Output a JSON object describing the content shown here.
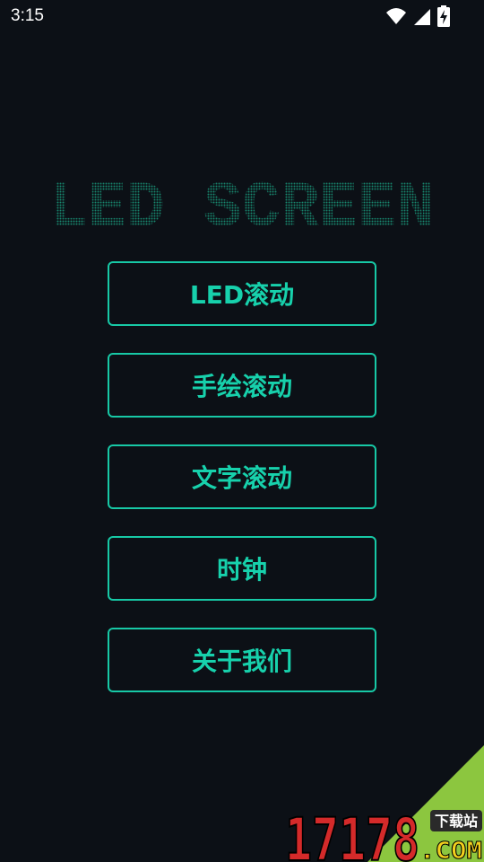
{
  "status_bar": {
    "time": "3:15",
    "icons": [
      "wifi-icon",
      "cell-signal-icon",
      "battery-charging-icon"
    ]
  },
  "header": {
    "title": "LED SCREEN",
    "title_color": "#1fd3a8"
  },
  "menu": {
    "items": [
      {
        "label": "LED滚动"
      },
      {
        "label": "手绘滚动"
      },
      {
        "label": "文字滚动"
      },
      {
        "label": "时钟"
      },
      {
        "label": "关于我们"
      }
    ],
    "accent_color": "#17c9a6"
  },
  "watermark": {
    "brand_number": "17178",
    "domain": ".COM",
    "badge": "下载站"
  }
}
